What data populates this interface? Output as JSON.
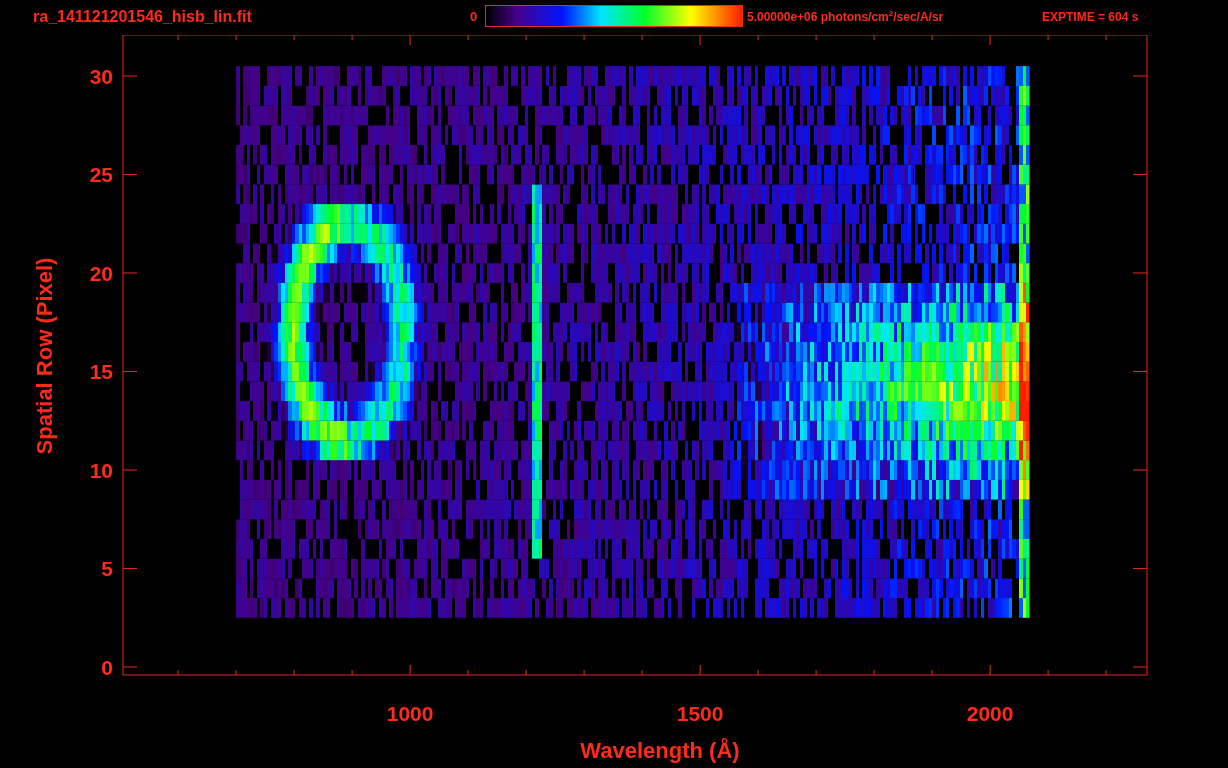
{
  "header": {
    "filename": "ra_141121201546_hisb_lin.fit",
    "colorbar": {
      "min_label": "0",
      "max_label": "5.00000e+06 photons/cm$^{2}$/sec/A/sr"
    },
    "exposure": "EXPTIME = 604 s"
  },
  "plot": {
    "xlabel": "Wavelength (Å)",
    "ylabel": "Spatial Row (Pixel)",
    "xtick_labels": [
      "1000",
      "1500",
      "2000"
    ],
    "ytick_labels": [
      "30",
      "25",
      "20",
      "15",
      "10",
      "5",
      "0"
    ]
  }
}
